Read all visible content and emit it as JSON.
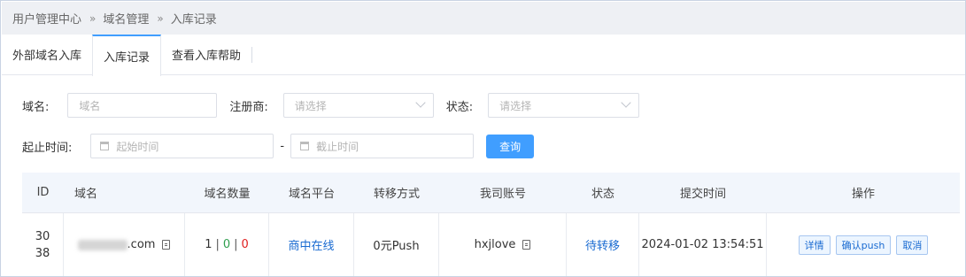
{
  "breadcrumb": {
    "items": [
      "用户管理中心",
      "域名管理",
      "入库记录"
    ],
    "separator": "»"
  },
  "tabs": [
    {
      "label": "外部域名入库",
      "active": false
    },
    {
      "label": "入库记录",
      "active": true
    },
    {
      "label": "查看入库帮助",
      "active": false
    }
  ],
  "filters": {
    "domain_label": "域名:",
    "domain_placeholder": "域名",
    "registrar_label": "注册商:",
    "registrar_placeholder": "请选择",
    "status_label": "状态:",
    "status_placeholder": "请选择",
    "time_label": "起止时间:",
    "start_placeholder": "起始时间",
    "range_sep": "-",
    "end_placeholder": "截止时间",
    "query_label": "查询"
  },
  "table": {
    "headers": [
      "ID",
      "域名",
      "域名数量",
      "域名平台",
      "转移方式",
      "我司账号",
      "状态",
      "提交时间",
      "操作"
    ],
    "rows": [
      {
        "id": "3038",
        "domain_suffix": ".com",
        "count_total": "1",
        "count_green": "0",
        "count_red": "0",
        "platform": "商中在线",
        "transfer": "0元Push",
        "account": "hxjlove",
        "status": "待转移",
        "time": "2024-01-02 13:54:51",
        "ops": [
          "详情",
          "确认push",
          "取消"
        ]
      }
    ]
  },
  "colors": {
    "accent": "#409eff",
    "link": "#1a6bd1",
    "green": "#2f9e4e",
    "red": "#e02020"
  }
}
